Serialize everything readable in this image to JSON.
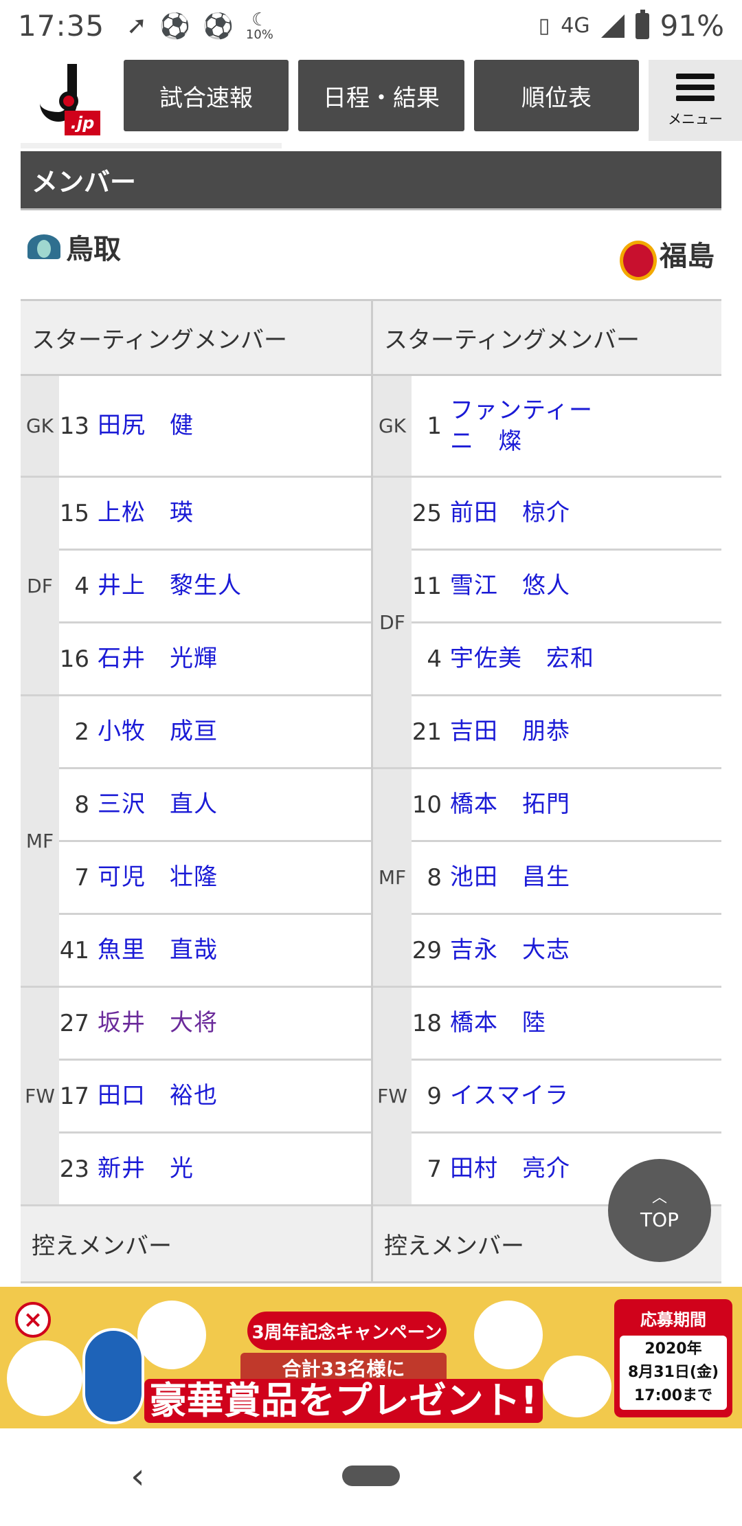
{
  "status_bar": {
    "time": "17:35",
    "icons": [
      "nfc-icon",
      "soccer-ball-icon",
      "soccer-ball-icon",
      "moon-icon"
    ],
    "moon_percent": "10%",
    "network": "4G",
    "battery": "91%"
  },
  "header": {
    "logo_text": ".jp",
    "nav": [
      "試合速報",
      "日程・結果",
      "順位表"
    ],
    "menu_label": "メニュー"
  },
  "section_title": "メンバー",
  "teams": {
    "home": "鳥取",
    "away": "福島"
  },
  "lineup": {
    "starting_header": "スターティングメンバー",
    "subs_header": "控えメンバー",
    "home": [
      {
        "pos": "GK",
        "players": [
          {
            "num": "13",
            "name": "田尻　健"
          }
        ]
      },
      {
        "pos": "DF",
        "players": [
          {
            "num": "15",
            "name": "上松　瑛"
          },
          {
            "num": "4",
            "name": "井上　黎生人"
          },
          {
            "num": "16",
            "name": "石井　光輝"
          }
        ]
      },
      {
        "pos": "MF",
        "players": [
          {
            "num": "2",
            "name": "小牧　成亘"
          },
          {
            "num": "8",
            "name": "三沢　直人"
          },
          {
            "num": "7",
            "name": "可児　壮隆"
          },
          {
            "num": "41",
            "name": "魚里　直哉"
          }
        ]
      },
      {
        "pos": "FW",
        "players": [
          {
            "num": "27",
            "name": "坂井　大将"
          },
          {
            "num": "17",
            "name": "田口　裕也"
          },
          {
            "num": "23",
            "name": "新井　光"
          }
        ]
      }
    ],
    "away": [
      {
        "pos": "GK",
        "players": [
          {
            "num": "1",
            "name": "ファンティーニ　燦"
          }
        ]
      },
      {
        "pos": "DF",
        "players": [
          {
            "num": "25",
            "name": "前田　椋介"
          },
          {
            "num": "11",
            "name": "雪江　悠人"
          },
          {
            "num": "4",
            "name": "宇佐美　宏和"
          },
          {
            "num": "21",
            "name": "吉田　朋恭"
          }
        ]
      },
      {
        "pos": "MF",
        "players": [
          {
            "num": "10",
            "name": "橋本　拓門"
          },
          {
            "num": "8",
            "name": "池田　昌生"
          },
          {
            "num": "29",
            "name": "吉永　大志"
          }
        ]
      },
      {
        "pos": "FW",
        "players": [
          {
            "num": "18",
            "name": "橋本　陸"
          },
          {
            "num": "9",
            "name": "イスマイラ"
          },
          {
            "num": "7",
            "name": "田村　亮介"
          }
        ]
      }
    ]
  },
  "top_button": "TOP",
  "ad": {
    "campaign": "3周年記念キャンペーン",
    "subtitle": "合計33名様に",
    "headline": "豪華賞品をプレゼント!",
    "period_title": "応募期間",
    "period_line1": "2020年",
    "period_line2": "8月31日(金)",
    "period_line3": "17:00まで"
  }
}
